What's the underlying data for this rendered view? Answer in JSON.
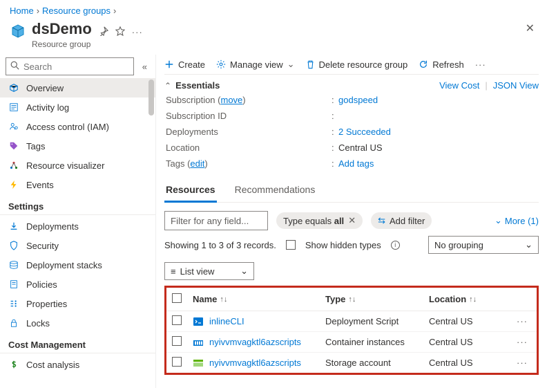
{
  "breadcrumb": {
    "home": "Home",
    "rg": "Resource groups"
  },
  "title": "dsDemo",
  "subtitle": "Resource group",
  "search": {
    "placeholder": "Search"
  },
  "nav": {
    "topItems": [
      {
        "label": "Overview",
        "icon": "cube",
        "active": true
      },
      {
        "label": "Activity log",
        "icon": "log"
      },
      {
        "label": "Access control (IAM)",
        "icon": "iam"
      },
      {
        "label": "Tags",
        "icon": "tag"
      },
      {
        "label": "Resource visualizer",
        "icon": "viz"
      },
      {
        "label": "Events",
        "icon": "bolt"
      }
    ],
    "section1": "Settings",
    "settingsItems": [
      {
        "label": "Deployments",
        "icon": "deploy"
      },
      {
        "label": "Security",
        "icon": "shield"
      },
      {
        "label": "Deployment stacks",
        "icon": "stacks"
      },
      {
        "label": "Policies",
        "icon": "policy"
      },
      {
        "label": "Properties",
        "icon": "props"
      },
      {
        "label": "Locks",
        "icon": "lock"
      }
    ],
    "section2": "Cost Management",
    "costItems": [
      {
        "label": "Cost analysis",
        "icon": "dollar"
      }
    ]
  },
  "cmdbar": {
    "create": "Create",
    "manage": "Manage view",
    "delete": "Delete resource group",
    "refresh": "Refresh"
  },
  "essentials": {
    "header": "Essentials",
    "viewcost": "View Cost",
    "jsonview": "JSON View",
    "rows": {
      "sub_label": "Subscription",
      "move": "move",
      "sub_value": "godspeed",
      "subid_label": "Subscription ID",
      "subid_value": "",
      "dep_label": "Deployments",
      "dep_value": "2 Succeeded",
      "loc_label": "Location",
      "loc_value": "Central US",
      "tags_label": "Tags",
      "edit": "edit",
      "tags_value": "Add tags"
    }
  },
  "tabs": {
    "resources": "Resources",
    "reco": "Recommendations"
  },
  "filters": {
    "placeholder": "Filter for any field...",
    "chipPrefix": "Type equals ",
    "chipValue": "all",
    "addfilter": "Add filter",
    "more": "More (1)"
  },
  "below": {
    "records": "Showing 1 to 3 of 3 records.",
    "hidden": "Show hidden types",
    "grouping": "No grouping",
    "listview": "List view"
  },
  "table": {
    "cols": {
      "name": "Name",
      "type": "Type",
      "loc": "Location"
    },
    "rows": [
      {
        "name": "inlineCLI",
        "type": "Deployment Script",
        "loc": "Central US",
        "icon": "script"
      },
      {
        "name": "nyivvmvagktl6azscripts",
        "type": "Container instances",
        "loc": "Central US",
        "icon": "container"
      },
      {
        "name": "nyivvmvagktl6azscripts",
        "type": "Storage account",
        "loc": "Central US",
        "icon": "storage"
      }
    ]
  }
}
